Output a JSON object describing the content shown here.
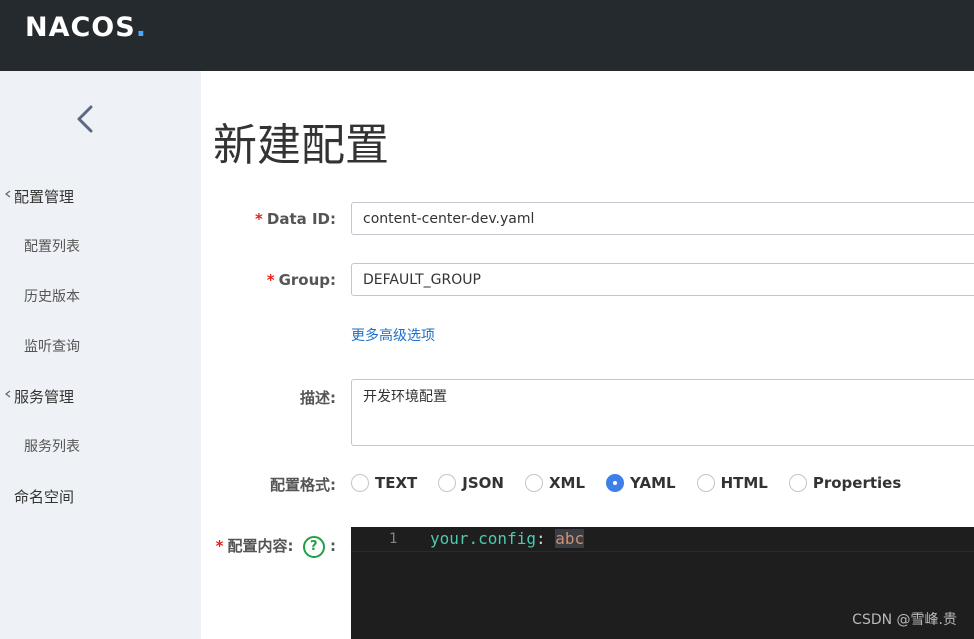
{
  "header": {
    "logo_text": "NACOS",
    "logo_dot": "."
  },
  "sidebar": {
    "groups": [
      {
        "label": "配置管理",
        "items": [
          "配置列表",
          "历史版本",
          "监听查询"
        ]
      },
      {
        "label": "服务管理",
        "items": [
          "服务列表"
        ]
      },
      {
        "label": "命名空间",
        "items": []
      }
    ]
  },
  "form": {
    "title": "新建配置",
    "data_id": {
      "label": "Data ID:",
      "value": "content-center-dev.yaml"
    },
    "group": {
      "label": "Group:",
      "value": "DEFAULT_GROUP"
    },
    "advanced_link": "更多高级选项",
    "description": {
      "label": "描述:",
      "value": "开发环境配置"
    },
    "format": {
      "label": "配置格式:",
      "options": [
        "TEXT",
        "JSON",
        "XML",
        "YAML",
        "HTML",
        "Properties"
      ],
      "selected": "YAML"
    },
    "content": {
      "label": "配置内容:",
      "colon": ":",
      "help_symbol": "?",
      "line_number": "1",
      "code_key": "your.config",
      "code_sep": ": ",
      "code_value": "abc"
    }
  },
  "watermark": "CSDN @雪峰.贵",
  "colors": {
    "header_bg": "#252a2f",
    "sidebar_bg": "#eef1f5",
    "accent": "#3f7fea",
    "link": "#1c6fc9",
    "required": "#e2231a",
    "editor_bg": "#1e1e1e"
  }
}
